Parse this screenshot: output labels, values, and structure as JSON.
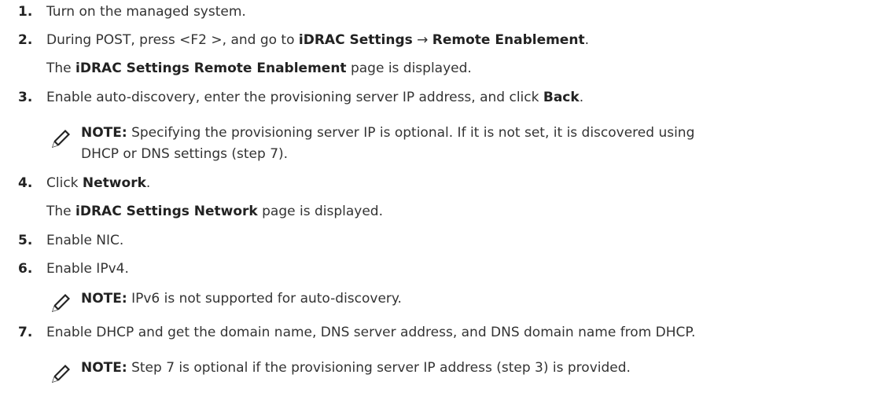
{
  "steps": {
    "s1": {
      "num": "1.",
      "text": "Turn on the managed system."
    },
    "s2": {
      "num": "2.",
      "pre": "During POST, press <F2 >, and go to ",
      "bold1": "iDRAC Settings",
      "arrow": " → ",
      "bold2": "Remote Enablement",
      "post": ".",
      "sub_pre": "The ",
      "sub_bold": "iDRAC Settings Remote Enablement",
      "sub_post": " page is displayed."
    },
    "s3": {
      "num": "3.",
      "pre": "Enable auto-discovery, enter the provisioning server IP address, and click ",
      "bold": "Back",
      "post": "."
    },
    "note1": {
      "label": "NOTE:",
      "line1": " Specifying the provisioning server IP is optional. If it is not set, it is discovered using",
      "line2": "DHCP or DNS settings (step 7)."
    },
    "s4": {
      "num": "4.",
      "pre": "Click ",
      "bold": "Network",
      "post": ".",
      "sub_pre": "The ",
      "sub_bold": "iDRAC Settings Network",
      "sub_post": " page is displayed."
    },
    "s5": {
      "num": "5.",
      "text": "Enable NIC."
    },
    "s6": {
      "num": "6.",
      "text": "Enable IPv4."
    },
    "note2": {
      "label": "NOTE:",
      "text": " IPv6 is not supported for auto-discovery."
    },
    "s7": {
      "num": "7.",
      "text": "Enable DHCP and get the domain name, DNS server address, and DNS domain name from DHCP."
    },
    "note3": {
      "label": "NOTE:",
      "text": " Step 7 is optional if the provisioning server IP address (step 3) is provided."
    }
  },
  "icons": {
    "note": "pencil-note-icon"
  }
}
